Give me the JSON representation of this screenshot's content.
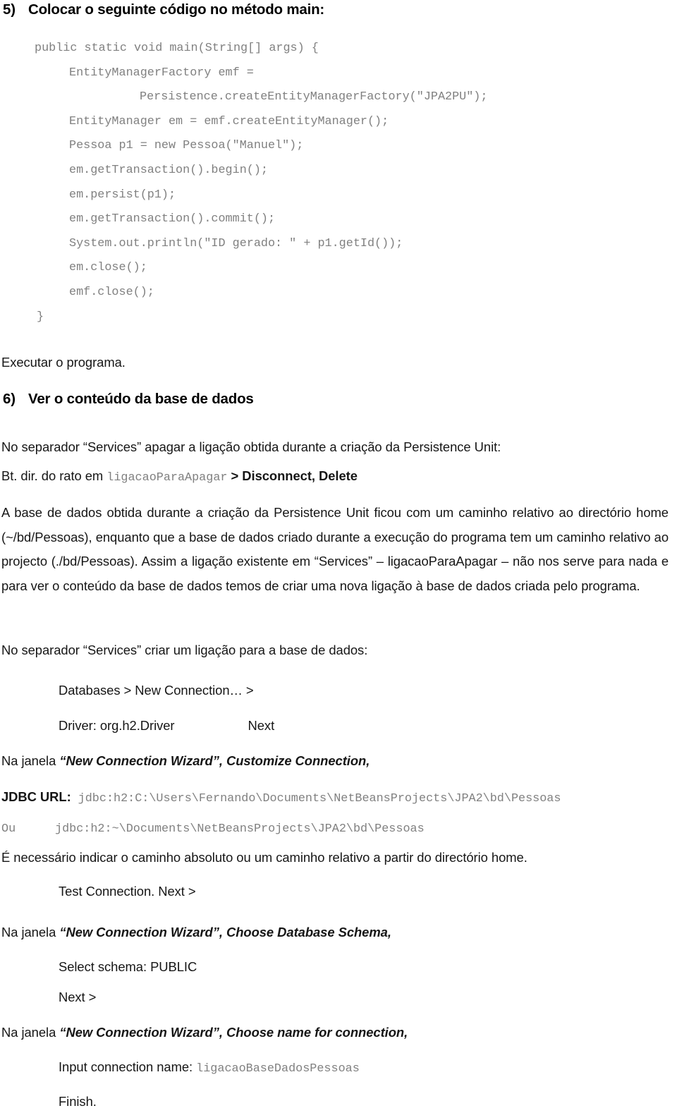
{
  "document": {
    "language": "pt-PT",
    "topic": "JPA2 / NetBeans - criar ligacao a base de dados H2",
    "colors": {
      "body_text": "#161616",
      "code_text": "#808080",
      "background": "#ffffff"
    }
  },
  "section5": {
    "number": "5)",
    "title": "Colocar o seguinte código no método main:",
    "code_lines": [
      {
        "indent": 0,
        "text": "public static void main(String[] args) {"
      },
      {
        "indent": 1,
        "text": "EntityManagerFactory emf ="
      },
      {
        "indent": 2,
        "text": "Persistence.createEntityManagerFactory(\"JPA2PU\");"
      },
      {
        "indent": 1,
        "text": "EntityManager em = emf.createEntityManager();"
      },
      {
        "indent": 1,
        "text": "Pessoa p1 = new Pessoa(\"Manuel\");"
      },
      {
        "indent": 1,
        "text": "em.getTransaction().begin();"
      },
      {
        "indent": 1,
        "text": "em.persist(p1);"
      },
      {
        "indent": 1,
        "text": "em.getTransaction().commit();"
      },
      {
        "indent": 1,
        "text": "System.out.println(\"ID gerado: \" + p1.getId());"
      },
      {
        "indent": 1,
        "text": "em.close();"
      },
      {
        "indent": 1,
        "text": "emf.close();"
      },
      {
        "indent": 0,
        "text": "}"
      }
    ],
    "after_code": "Executar o programa."
  },
  "section6": {
    "number": "6)",
    "title": "Ver o conteúdo da base de dados",
    "intro_services_delete": "No separador “Services” apagar a ligação obtida durante a criação da Persistence Unit:",
    "right_click_line": {
      "prefix": "Bt. dir. do rato em ",
      "code": "ligacaoParaApagar",
      "suffix": "  >   Disconnect,   Delete"
    },
    "explanation": "A base de dados obtida durante a criação da Persistence Unit ficou com um caminho relativo ao directório home (~/bd/Pessoas), enquanto que a base de dados criado durante a execução do programa tem um caminho relativo ao projecto (./bd/Pessoas). Assim a ligação existente em “Services” – ligacaoParaApagar – não nos serve para nada e para ver o conteúdo da base de dados temos de criar uma nova ligação à base de dados criada pelo programa.",
    "intro_services_create": "No separador “Services” criar um ligação para a base de dados:",
    "databases_path": "Databases  >  New Connection…  >",
    "driver_line": "Driver: org.h2.Driver",
    "driver_next": "Next",
    "wizard_customize": {
      "prefix": "Na janela ",
      "window": "“New Connection Wizard”, Customize Connection,"
    },
    "jdbc": {
      "label": "JDBC URL:",
      "url": "jdbc:h2:C:\\Users\\Fernando\\Documents\\NetBeansProjects\\JPA2\\bd\\Pessoas"
    },
    "alternative": {
      "label": "Ou",
      "url": "jdbc:h2:~\\Documents\\NetBeansProjects\\JPA2\\bd\\Pessoas"
    },
    "note_absolute_path": "É necessário indicar o caminho absoluto ou um caminho relativo a partir do directório home.",
    "test_connection": "Test Connection. Next >",
    "wizard_schema": {
      "prefix": "Na janela ",
      "window": "“New Connection Wizard”, Choose Database Schema,"
    },
    "select_schema": "Select schema: PUBLIC",
    "next_button": "Next >",
    "wizard_name": {
      "prefix": "Na janela ",
      "window": "“New Connection Wizard”, Choose name for connection,"
    },
    "input_connection_name": {
      "label": "Input connection name: ",
      "value": "ligacaoBaseDadosPessoas"
    },
    "finish": "Finish."
  }
}
